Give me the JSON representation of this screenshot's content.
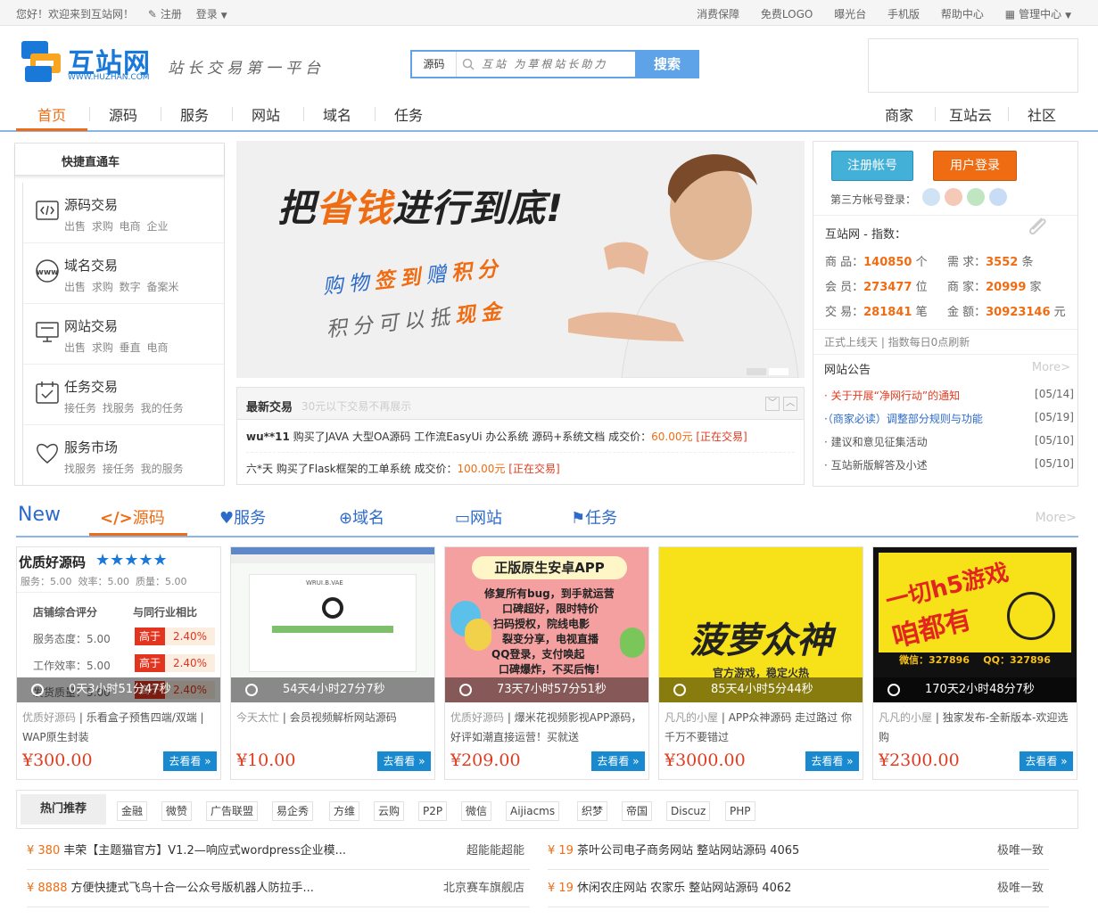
{
  "topbar": {
    "welcome": "您好！欢迎来到互站网！",
    "register": "注册",
    "login": "登录",
    "links": [
      "消费保障",
      "免费LOGO",
      "曝光台",
      "手机版",
      "帮助中心"
    ],
    "admin": "管理中心"
  },
  "logo": {
    "name": "互站网",
    "url": "WWW.HUZHAN.COM"
  },
  "slogan": "站长交易第一平台",
  "search": {
    "category": "源码",
    "placeholder": "互站 为草根站长助力",
    "button": "搜索"
  },
  "nav": {
    "left": [
      "首页",
      "源码",
      "服务",
      "网站",
      "域名",
      "任务"
    ],
    "right": [
      "商家",
      "互站云",
      "社区"
    ]
  },
  "quick": {
    "title": "快捷直通车",
    "items": [
      {
        "title": "源码交易",
        "sub": "出售 求购 电商 企业"
      },
      {
        "title": "域名交易",
        "sub": "出售 求购 数字 备案米"
      },
      {
        "title": "网站交易",
        "sub": "出售 求购 垂直 电商"
      },
      {
        "title": "任务交易",
        "sub": "接任务 找服务 我的任务"
      },
      {
        "title": "服务市场",
        "sub": "找服务 接任务 我的服务"
      }
    ]
  },
  "banner": {
    "line1a": "把",
    "line1b": "省钱",
    "line1c": "进行到底!",
    "line2a": "购物",
    "line2b": "签到",
    "line2c": "赠",
    "line2d": "积分",
    "line3a": "积分可以抵",
    "line3b": "现金"
  },
  "trades": {
    "title": "最新交易",
    "note": "30元以下交易不再展示",
    "rows": [
      {
        "user": "wu**11",
        "text": "购买了JAVA 大型OA源码 工作流EasyUi 办公系统 源码+系统文档 成交价：",
        "price": "60.00元",
        "status": "[正在交易]"
      },
      {
        "user": "六*天",
        "text": "购买了Flask框架的工单系统 成交价：",
        "price": "100.00元",
        "status": "[正在交易]"
      }
    ]
  },
  "user": {
    "register": "注册帐号",
    "login": "用户登录",
    "third": "第三方帐号登录：",
    "index_title": "互站网 - 指数：",
    "stats": [
      {
        "label": "商 品：",
        "value": "140850",
        "unit": "个"
      },
      {
        "label": "需 求：",
        "value": "3552",
        "unit": "条"
      },
      {
        "label": "会 员：",
        "value": "273477",
        "unit": "位"
      },
      {
        "label": "商 家：",
        "value": "20999",
        "unit": "家"
      },
      {
        "label": "交 易：",
        "value": "281841",
        "unit": "笔"
      },
      {
        "label": "金 额：",
        "value": "30923146",
        "unit": "元"
      }
    ],
    "foot": "正式上线天 | 指数每日0点刷新",
    "notice_title": "网站公告",
    "notice_more": "More>",
    "notices": [
      {
        "text": "· 关于开展“净网行动”的通知",
        "date": "[05/14]",
        "color": "#e23a1f"
      },
      {
        "text": "·（商家必读）调整部分规则与功能",
        "date": "[05/19]",
        "color": "#2c6bc9"
      },
      {
        "text": "· 建议和意见征集活动",
        "date": "[05/10]",
        "color": "#555555"
      },
      {
        "text": "· 互站新版解答及小述",
        "date": "[05/10]",
        "color": "#555555"
      }
    ]
  },
  "newtabs": {
    "new": "New",
    "tabs": [
      "源码",
      "服务",
      "域名",
      "网站",
      "任务"
    ],
    "more": "More>"
  },
  "cards": [
    {
      "timer": "0天3小时51分47秒",
      "shop": "优质好源码",
      "desc": " | 乐看盒子预售四端/双端 | WAP原生封装",
      "price": "¥300.00",
      "img_title": "优质好源码",
      "img_scores": "服务：5.00  效率：5.00  质量：5.00",
      "img_h1": "店铺综合评分",
      "img_h2": "与同行业相比",
      "img_rows": [
        {
          "k": "服务态度：5.00",
          "c": "高于",
          "v": "2.40%"
        },
        {
          "k": "工作效率：5.00",
          "c": "高于",
          "v": "2.40%"
        },
        {
          "k": "发货质量：5.00",
          "c": "高于",
          "v": "2.40%"
        }
      ]
    },
    {
      "timer": "54天4小时27分7秒",
      "shop": "今天太忙",
      "desc": " | 会员视频解析网站源码",
      "price": "¥10.00",
      "img_site": "WRUI.B.VAE"
    },
    {
      "timer": "73天7小时57分51秒",
      "shop": "优质好源码",
      "desc": " | 爆米花视频影视APP源码，好评如潮直接运营！买就送",
      "price": "¥209.00",
      "img_title": "正版原生安卓APP",
      "img_lines": [
        "修复所有bug，到手就运营",
        "口碑超好，限时特价",
        "扫码授权，院线电影",
        "裂变分享，电视直播",
        "QQ登录，支付唤起",
        "口碑爆炸，不买后悔！"
      ]
    },
    {
      "timer": "85天4小时5分44秒",
      "shop": "凡凡的小屋",
      "desc": " | APP众神源码 走过路过 你千万不要错过",
      "price": "¥3000.00",
      "img_title": "菠萝众神",
      "img_sub": "官方游戏，稳定火热"
    },
    {
      "timer": "170天2小时48分7秒",
      "shop": "凡凡的小屋",
      "desc": " | 独家发布-全新版本-欢迎选购",
      "price": "¥2300.00",
      "img_title": "一切h5游戏",
      "img_title2": "咱都有",
      "img_contact": "微信：327896    QQ：327896"
    }
  ],
  "go_label": "去看看 »",
  "hot": {
    "label": "热门推荐",
    "tags": [
      "金融",
      "微赞",
      "广告联盟",
      "易企秀",
      "方维",
      "云购",
      "P2P",
      "微信",
      "Aijiacms",
      "织梦",
      "帝国",
      "Discuz",
      "PHP"
    ],
    "rows": [
      {
        "price": "¥ 380",
        "title": "丰荣【主题猫官方】V1.2—响应式wordpress企业模...",
        "shop": "超能能超能"
      },
      {
        "price": "¥ 19",
        "title": "茶叶公司电子商务网站 整站网站源码 4065",
        "shop": "极唯一致"
      },
      {
        "price": "¥ 8888",
        "title": "方便快捷式飞鸟十合一公众号版机器人防拉手...",
        "shop": "北京赛车旗舰店"
      },
      {
        "price": "¥ 19",
        "title": "休闲农庄网站 农家乐 整站网站源码 4062",
        "shop": "极唯一致"
      }
    ]
  },
  "colors": {
    "accent": "#ef6c13",
    "blue": "#2c6bc9",
    "price": "#e23a1f"
  }
}
